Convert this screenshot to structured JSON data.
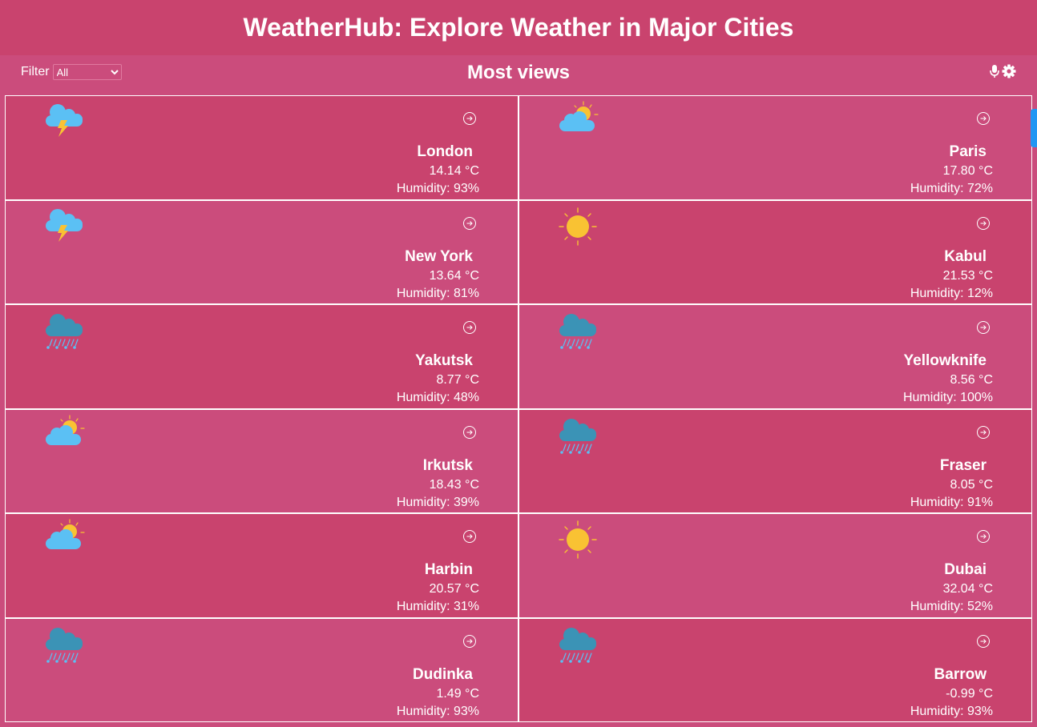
{
  "header": {
    "title": "WeatherHub: Explore Weather in Major Cities"
  },
  "toolbar": {
    "filter_label": "Filter",
    "filter_value": "All",
    "section_title": "Most views",
    "icons": [
      "microphone-icon",
      "gear-icon"
    ]
  },
  "colors": {
    "header_bg": "#c9436e",
    "page_bg": "#cb4c7c",
    "sun": "#f9c233",
    "cloud": "#5bc0f4",
    "rain_cloud": "#3b93b6"
  },
  "cities": [
    {
      "name": "London",
      "temp": "14.14 °C",
      "humidity": "Humidity: 93%",
      "icon": "thunderstorm-icon"
    },
    {
      "name": "Paris",
      "temp": "17.80 °C",
      "humidity": "Humidity: 72%",
      "icon": "partly-cloudy-icon"
    },
    {
      "name": "New York",
      "temp": "13.64 °C",
      "humidity": "Humidity: 81%",
      "icon": "thunderstorm-icon"
    },
    {
      "name": "Kabul",
      "temp": "21.53 °C",
      "humidity": "Humidity: 12%",
      "icon": "sun-icon"
    },
    {
      "name": "Yakutsk",
      "temp": "8.77 °C",
      "humidity": "Humidity: 48%",
      "icon": "rain-icon"
    },
    {
      "name": "Yellowknife",
      "temp": "8.56 °C",
      "humidity": "Humidity: 100%",
      "icon": "rain-icon"
    },
    {
      "name": "Irkutsk",
      "temp": "18.43 °C",
      "humidity": "Humidity: 39%",
      "icon": "partly-cloudy-icon"
    },
    {
      "name": "Fraser",
      "temp": "8.05 °C",
      "humidity": "Humidity: 91%",
      "icon": "rain-icon"
    },
    {
      "name": "Harbin",
      "temp": "20.57 °C",
      "humidity": "Humidity: 31%",
      "icon": "partly-cloudy-icon"
    },
    {
      "name": "Dubai",
      "temp": "32.04 °C",
      "humidity": "Humidity: 52%",
      "icon": "sun-icon"
    },
    {
      "name": "Dudinka",
      "temp": "1.49 °C",
      "humidity": "Humidity: 93%",
      "icon": "rain-icon"
    },
    {
      "name": "Barrow",
      "temp": "-0.99 °C",
      "humidity": "Humidity: 93%",
      "icon": "rain-icon"
    }
  ]
}
